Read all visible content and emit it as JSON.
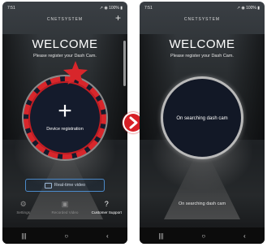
{
  "colors": {
    "highlight_red": "#d8262b",
    "arrow_red": "#d81f26",
    "accent_blue": "#4b89c8"
  },
  "left_screen": {
    "status_time": "7:51",
    "status_right": "↗ ◉ 100% ▮",
    "app_name": "CNETSYSTEM",
    "corner_icon": "+",
    "welcome": "WELCOME",
    "subtitle": "Please register your Dash Cam.",
    "register_icon": "+",
    "register_label": "Device registration",
    "highlight_icon": "star-icon",
    "realtime_button": "Real-time video",
    "tabs": [
      {
        "icon": "⚙",
        "label": "Settings"
      },
      {
        "icon": "▣",
        "label": "Recorded Video"
      },
      {
        "icon": "?",
        "label": "Customer Support"
      }
    ],
    "nav": [
      "|||",
      "○",
      "‹"
    ]
  },
  "right_screen": {
    "status_time": "7:51",
    "status_right": "↗ ◉ 100% ▮",
    "app_name": "CNETSYSTEM",
    "welcome": "WELCOME",
    "subtitle": "Please register your Dash Cam.",
    "circle_label": "On searching dash cam",
    "bottom_status": "On searching dash cam",
    "nav": [
      "|||",
      "○",
      "‹"
    ]
  },
  "transition_icon": "arrow-right-icon"
}
